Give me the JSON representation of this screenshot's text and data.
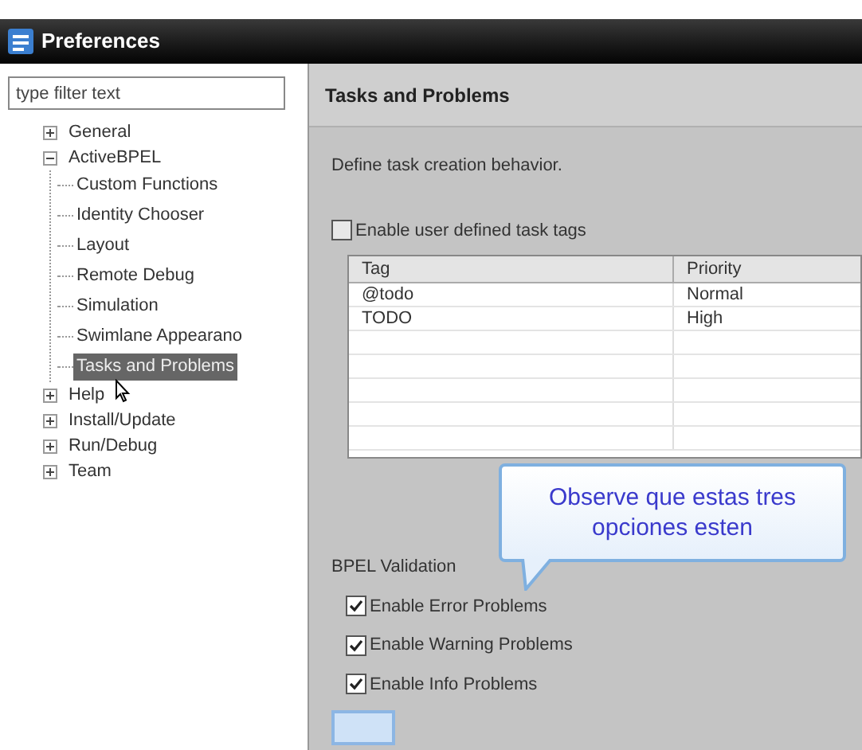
{
  "window": {
    "title": "Preferences"
  },
  "filter": {
    "placeholder": "type filter text"
  },
  "tree": [
    {
      "label": "General",
      "expanded": false,
      "selected": false
    },
    {
      "label": "ActiveBPEL",
      "expanded": true,
      "selected": false,
      "children": [
        {
          "label": "Custom Functions",
          "selected": false
        },
        {
          "label": "Identity Chooser",
          "selected": false
        },
        {
          "label": "Layout",
          "selected": false
        },
        {
          "label": "Remote Debug",
          "selected": false
        },
        {
          "label": "Simulation",
          "selected": false
        },
        {
          "label": "Swimlane Appearano",
          "selected": false
        },
        {
          "label": "Tasks and Problems",
          "selected": true
        }
      ]
    },
    {
      "label": "Help",
      "expanded": false,
      "selected": false
    },
    {
      "label": "Install/Update",
      "expanded": false,
      "selected": false
    },
    {
      "label": "Run/Debug",
      "expanded": false,
      "selected": false
    },
    {
      "label": "Team",
      "expanded": false,
      "selected": false
    }
  ],
  "page": {
    "title": "Tasks and Problems",
    "description": "Define task creation behavior.",
    "user_tags": {
      "label": "Enable user defined task tags",
      "checked": false
    },
    "table": {
      "columns": [
        "Tag",
        "Priority"
      ],
      "rows": [
        [
          "@todo",
          "Normal"
        ],
        [
          "TODO",
          "High"
        ]
      ]
    },
    "validation": {
      "heading": "BPEL Validation",
      "options": [
        {
          "label": "Enable Error Problems",
          "checked": true
        },
        {
          "label": "Enable Warning Problems",
          "checked": true
        },
        {
          "label": "Enable Info Problems",
          "checked": true
        }
      ]
    }
  },
  "callout": {
    "text": "Observe que estas tres opciones esten"
  }
}
